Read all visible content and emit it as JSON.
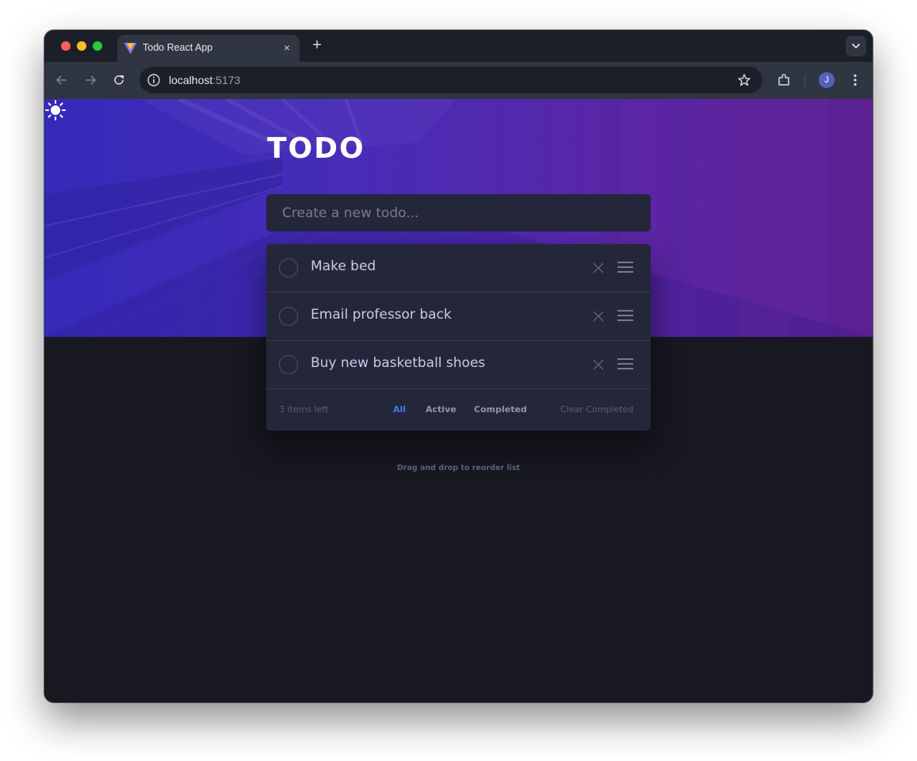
{
  "browser": {
    "tab_title": "Todo React App",
    "tab_close": "×",
    "new_tab": "+",
    "url_host": "localhost",
    "url_port": ":5173",
    "profile_initial": "J"
  },
  "app": {
    "title": "TODO",
    "input_placeholder": "Create a new todo...",
    "todos": [
      {
        "text": "Make bed",
        "completed": false
      },
      {
        "text": "Email professor back",
        "completed": false
      },
      {
        "text": "Buy new basketball shoes",
        "completed": false
      }
    ],
    "footer": {
      "items_left": "3 items left",
      "filters": [
        "All",
        "Active",
        "Completed"
      ],
      "selected_filter": "All",
      "clear_completed": "Clear Completed"
    },
    "hint": "Drag and drop to reorder list"
  },
  "colors": {
    "accent": "#3a7cfd",
    "page_bg": "#171820",
    "card_bg": "#24273a",
    "text": "#c8cbe7",
    "muted": "#5b5e7e"
  },
  "icons": [
    "vite-logo-icon",
    "close-icon",
    "plus-icon",
    "chevron-down-icon",
    "back-arrow-icon",
    "forward-arrow-icon",
    "reload-icon",
    "info-icon",
    "star-icon",
    "extensions-icon",
    "kebab-menu-icon",
    "sun-icon",
    "check-circle-icon",
    "delete-x-icon",
    "drag-handle-icon"
  ]
}
